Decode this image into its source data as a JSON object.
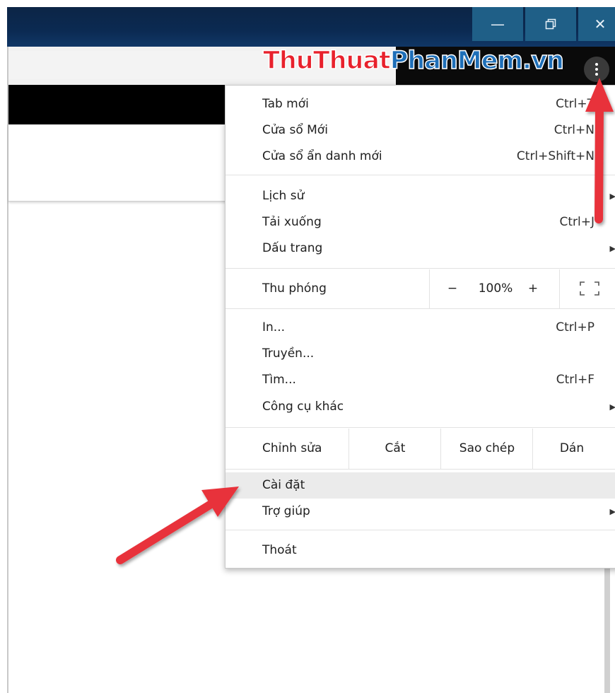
{
  "window": {
    "minimize_icon": "minimize-icon",
    "restore_icon": "restore-icon",
    "close_icon": "close-icon",
    "minimize_glyph": "—",
    "close_glyph": "✕"
  },
  "watermark": {
    "part1": "ThuThuat",
    "part2": "PhanMem.vn"
  },
  "menu": {
    "items_group1": [
      {
        "label": "Tab mới",
        "shortcut": "Ctrl+T"
      },
      {
        "label": "Cửa sổ Mới",
        "shortcut": "Ctrl+N"
      },
      {
        "label": "Cửa sổ ẩn danh mới",
        "shortcut": "Ctrl+Shift+N"
      }
    ],
    "items_group2": [
      {
        "label": "Lịch sử",
        "shortcut": ""
      },
      {
        "label": "Tải xuống",
        "shortcut": "Ctrl+J"
      },
      {
        "label": "Dấu trang",
        "shortcut": ""
      }
    ],
    "zoom": {
      "label": "Thu phóng",
      "minus": "−",
      "value": "100%",
      "plus": "+"
    },
    "items_group3": [
      {
        "label": "In...",
        "shortcut": "Ctrl+P"
      },
      {
        "label": "Truyền...",
        "shortcut": ""
      },
      {
        "label": "Tìm...",
        "shortcut": "Ctrl+F"
      },
      {
        "label": "Công cụ khác",
        "shortcut": ""
      }
    ],
    "edit": {
      "label": "Chỉnh sửa",
      "cut": "Cắt",
      "copy": "Sao chép",
      "paste": "Dán"
    },
    "items_group4": [
      {
        "label": "Cài đặt",
        "shortcut": ""
      },
      {
        "label": "Trợ giúp",
        "shortcut": ""
      }
    ],
    "exit": {
      "label": "Thoát"
    },
    "submenu_glyph": "▶"
  },
  "colors": {
    "arrow": "#e8323a",
    "highlight": "#ebebeb",
    "titlebar": "#0b2a52"
  }
}
